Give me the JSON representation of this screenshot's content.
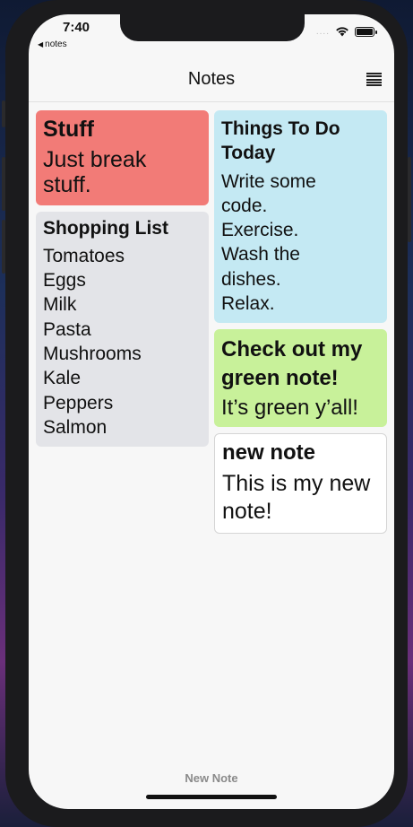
{
  "status_bar": {
    "time": "7:40",
    "back_label": "notes",
    "signal": "....",
    "icons": [
      "back-arrow-icon",
      "signal-icon",
      "wifi-icon",
      "battery-icon"
    ]
  },
  "nav": {
    "title": "Notes",
    "menu_icon": "list-menu-icon"
  },
  "notes_left": [
    {
      "title": "Stuff",
      "body": "Just break\nstuff.",
      "color": "#f27b77"
    },
    {
      "title": "Shopping List",
      "body": "Tomatoes\nEggs\nMilk\nPasta\nMushrooms\nKale\nPeppers\nSalmon",
      "color": "#e3e4e8"
    }
  ],
  "notes_right": [
    {
      "title": "Things To Do Today",
      "body": "Write some code.\nExercise.\nWash the dishes.\nRelax.",
      "color": "#c4e9f3"
    },
    {
      "title": "Check out my green note!",
      "body": "It’s green y’all!",
      "color": "#c8f19a"
    },
    {
      "title": "new note",
      "body": "This is my new note!",
      "color": "#ffffff"
    }
  ],
  "footer": {
    "new_note_label": "New Note"
  }
}
